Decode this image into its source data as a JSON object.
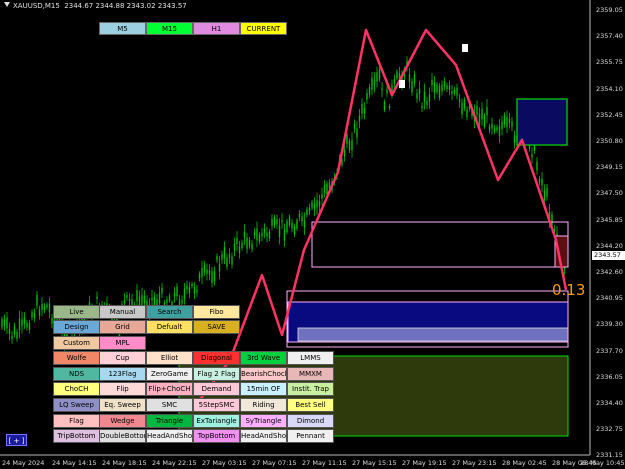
{
  "header": {
    "symbol": "XAUUSD,M15",
    "ohlc": "2344.67 2344.88 2343.02 2343.57"
  },
  "timeframes": [
    {
      "label": "M5",
      "color": "#9bd0e0"
    },
    {
      "label": "M15",
      "color": "#00ff33"
    },
    {
      "label": "H1",
      "color": "#e08ae0"
    },
    {
      "label": "CURRENT",
      "color": "#ffff00"
    }
  ],
  "price_axis": [
    "2359.05",
    "2357.40",
    "2355.75",
    "2354.10",
    "2352.45",
    "2350.80",
    "2349.15",
    "2347.50",
    "2345.85",
    "2344.20",
    "2342.60",
    "2340.95",
    "2339.30",
    "2337.70",
    "2336.05",
    "2334.40",
    "2332.75",
    "2331.15"
  ],
  "current_price": "2343.57",
  "time_axis": [
    "24 May 2024",
    "24 May 14:15",
    "24 May 18:15",
    "24 May 22:15",
    "27 May 03:15",
    "27 May 07:15",
    "27 May 11:15",
    "27 May 15:15",
    "27 May 19:15",
    "27 May 23:15",
    "28 May 02:45",
    "28 May 06:45",
    "28 May 10:45"
  ],
  "overlay_value": "0.13",
  "plus_button": "[ + ]",
  "panel": {
    "rows": [
      [
        {
          "label": "Live",
          "color": "#9ab88a"
        },
        {
          "label": "Manual",
          "color": "#c8c8c8"
        },
        {
          "label": "Search",
          "color": "#3fa0a0"
        },
        {
          "label": "Fibo",
          "color": "#ffe8a0"
        }
      ],
      [
        {
          "label": "Design",
          "color": "#6aa8d8"
        },
        {
          "label": "Grid",
          "color": "#e8a898"
        },
        {
          "label": "Defualt",
          "color": "#ffe060"
        },
        {
          "label": "SAVE",
          "color": "#d8b020"
        }
      ],
      [
        {
          "label": "Custom",
          "color": "#f0c8a0"
        },
        {
          "label": "MPL",
          "color": "#ff8cc8"
        }
      ],
      [
        {
          "label": "Wolfe",
          "color": "#f08868"
        },
        {
          "label": "Cup",
          "color": "#ffd0d8"
        },
        {
          "label": "Elliot",
          "color": "#ffe0c8"
        },
        {
          "label": "Diagonal",
          "color": "#ff3030"
        },
        {
          "label": "3rd Wave",
          "color": "#00d040"
        },
        {
          "label": "LMMS",
          "color": "#f0f0f0"
        }
      ],
      [
        {
          "label": "NDS",
          "color": "#50b8a0"
        },
        {
          "label": "123Flag",
          "color": "#a8d8f0"
        },
        {
          "label": "ZeroGame",
          "color": "#f0f0f0"
        },
        {
          "label": "Flag 2 Flag",
          "color": "#c8f0e0"
        },
        {
          "label": "BearishChoch",
          "color": "#ffc8c8"
        },
        {
          "label": "MMXM",
          "color": "#e8b8b8"
        }
      ],
      [
        {
          "label": "ChoCH",
          "color": "#ffff80"
        },
        {
          "label": "Flip",
          "color": "#ffd8d8"
        },
        {
          "label": "Flip+ChoCH",
          "color": "#ffb0c0"
        },
        {
          "label": "Demand",
          "color": "#ffc8d8"
        },
        {
          "label": "15min OF",
          "color": "#c8f0ff"
        },
        {
          "label": "Instit. Trap",
          "color": "#c8f0a0"
        }
      ],
      [
        {
          "label": "LQ Sweep",
          "color": "#9090c8"
        },
        {
          "label": "Eq. Sweep",
          "color": "#f0e0c8"
        },
        {
          "label": "SMC",
          "color": "#e0e0e0"
        },
        {
          "label": "5StepSMC",
          "color": "#ffc8d8"
        },
        {
          "label": "Riding",
          "color": "#f0e8d8"
        },
        {
          "label": "Best Sell",
          "color": "#ffff80"
        }
      ],
      [
        {
          "label": "Flag",
          "color": "#ffc0c0"
        },
        {
          "label": "Wedge",
          "color": "#f08890"
        },
        {
          "label": "Triangle",
          "color": "#00b840"
        },
        {
          "label": "ExTariangle",
          "color": "#a0f0e0"
        },
        {
          "label": "SyTriangle",
          "color": "#ffb0ff"
        },
        {
          "label": "Dimond",
          "color": "#d8d8f8"
        }
      ],
      [
        {
          "label": "TripBottom",
          "color": "#e0c0e0"
        },
        {
          "label": "DoubleBottom",
          "color": "#e0e0e0"
        },
        {
          "label": "HeadAndShould",
          "color": "#f0f0f0"
        },
        {
          "label": "TopBottom",
          "color": "#f090f0"
        },
        {
          "label": "HeadAndShould",
          "color": "#f0f0f0"
        },
        {
          "label": "Pennant",
          "color": "#f0f0f0"
        }
      ]
    ]
  }
}
